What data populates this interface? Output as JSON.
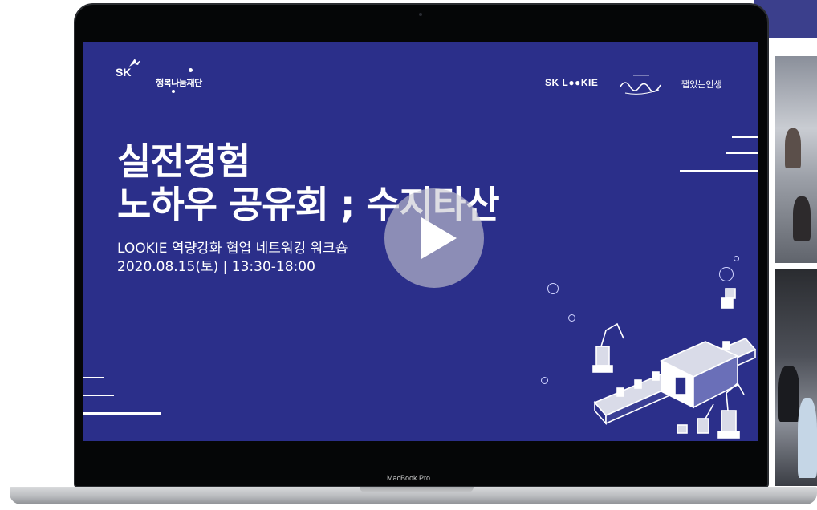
{
  "logos": {
    "sk": "SK",
    "foundation": "행복나눔재단",
    "lookie": "SK L●●KIE",
    "three": "쨉있는인생"
  },
  "slide": {
    "title_line1": "실전경험",
    "title_line2": "노하우 공유회 ; 수지타산",
    "subtitle": "LOOKIE 역량강화 협업 네트워킹 워크숍",
    "date": "2020.08.15(토) | 13:30-18:00"
  },
  "device": {
    "brand_label": "MacBook Pro"
  },
  "icons": {
    "play": "play-icon"
  },
  "colors": {
    "slide_background": "#2b2f8a",
    "bezel": "#050607",
    "accent_white": "#ffffff"
  }
}
